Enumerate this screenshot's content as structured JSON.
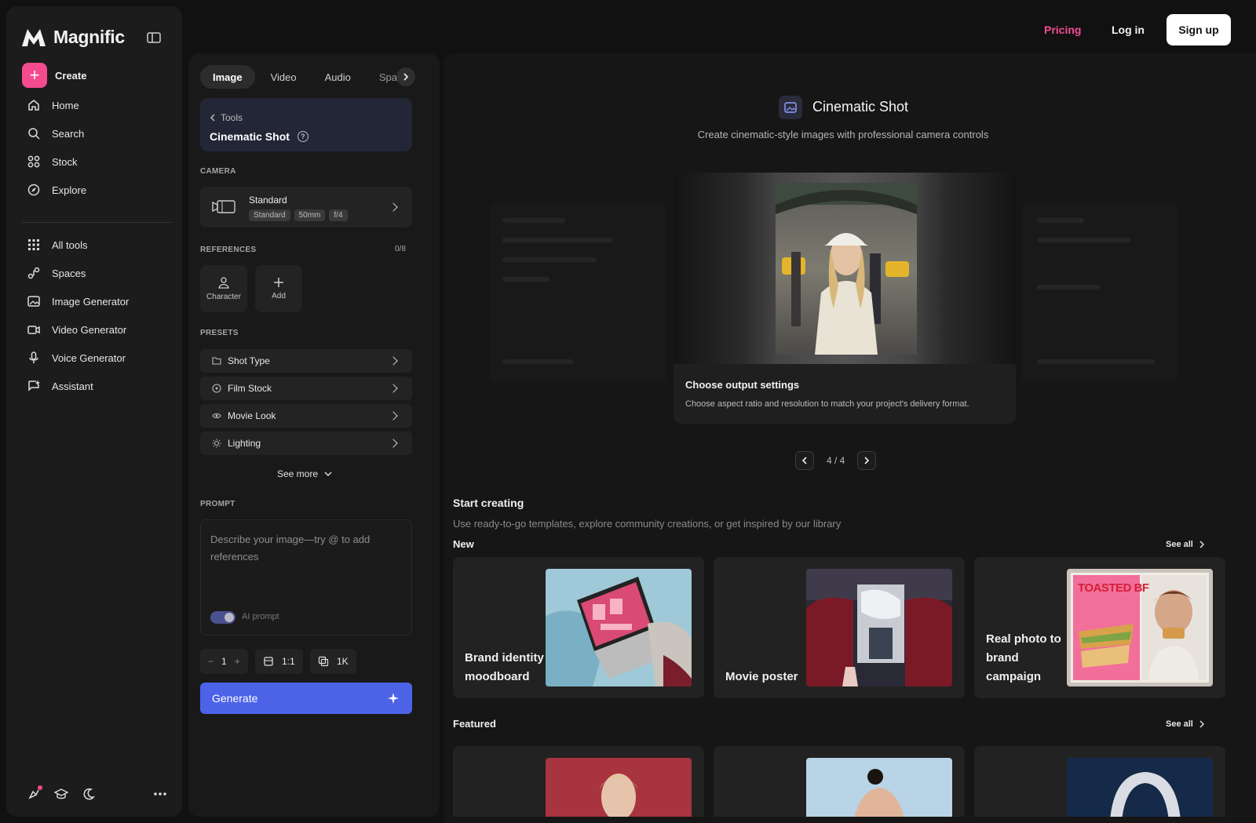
{
  "app": {
    "name": "Magnific"
  },
  "sidebar": {
    "create_label": "Create",
    "primary": [
      {
        "label": "Home",
        "icon": "home-icon"
      },
      {
        "label": "Search",
        "icon": "search-icon"
      },
      {
        "label": "Stock",
        "icon": "stock-icon"
      },
      {
        "label": "Explore",
        "icon": "explore-icon"
      }
    ],
    "secondary": [
      {
        "label": "All tools",
        "icon": "grid-icon"
      },
      {
        "label": "Spaces",
        "icon": "spaces-icon"
      },
      {
        "label": "Image Generator",
        "icon": "image-icon"
      },
      {
        "label": "Video Generator",
        "icon": "video-icon"
      },
      {
        "label": "Voice Generator",
        "icon": "mic-icon"
      },
      {
        "label": "Assistant",
        "icon": "assistant-icon"
      }
    ]
  },
  "topbar": {
    "pricing": "Pricing",
    "login": "Log in",
    "signup": "Sign up",
    "accent": "#f24e94"
  },
  "panel": {
    "tabs": [
      "Image",
      "Video",
      "Audio",
      "Spaces"
    ],
    "active_tab": "Image",
    "breadcrumb": "Tools",
    "tool_title": "Cinematic Shot",
    "camera_label": "CAMERA",
    "camera": {
      "name": "Standard",
      "tags": [
        "Standard",
        "50mm",
        "f/4"
      ]
    },
    "references_label": "REFERENCES",
    "references_count": "0/8",
    "references": [
      {
        "label": "Character"
      },
      {
        "label": "Add"
      }
    ],
    "presets_label": "PRESETS",
    "presets": [
      {
        "label": "Shot Type",
        "icon": "folder-icon"
      },
      {
        "label": "Film Stock",
        "icon": "film-icon"
      },
      {
        "label": "Movie Look",
        "icon": "eye-icon"
      },
      {
        "label": "Lighting",
        "icon": "sun-icon"
      }
    ],
    "see_more": "See more",
    "prompt_label": "PROMPT",
    "prompt_placeholder": "Describe your image—try @ to add references",
    "ai_prompt_label": "AI prompt",
    "ai_prompt_on": true,
    "count": "1",
    "aspect": "1:1",
    "resolution": "1K",
    "generate": "Generate",
    "generate_color": "#4c63e8"
  },
  "main": {
    "title": "Cinematic Shot",
    "subtitle": "Create cinematic-style images with professional camera controls",
    "slide": {
      "heading": "Choose output settings",
      "text": "Choose aspect ratio and resolution to match your project's delivery format."
    },
    "pager": "4 / 4",
    "start_title": "Start creating",
    "start_subtitle": "Use ready-to-go templates, explore community creations, or get inspired by our library",
    "new_label": "New",
    "featured_label": "Featured",
    "see_all": "See all",
    "templates": [
      {
        "label": "Brand identity moodboard"
      },
      {
        "label": "Movie poster"
      },
      {
        "label": "Real photo to brand campaign"
      }
    ],
    "poster_text": "TOASTED BF"
  }
}
